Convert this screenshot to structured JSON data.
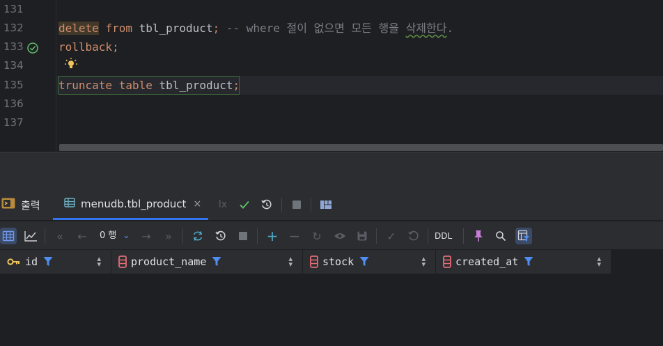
{
  "editor": {
    "line_numbers": [
      "131",
      "132",
      "133",
      "134",
      "135",
      "136",
      "137"
    ],
    "line132": {
      "kw_delete": "delete",
      "kw_from": "from",
      "ident": "tbl_product",
      "semicolon": ";",
      "comment_prefix": "-- where 절이 없으면 모든 행을 ",
      "comment_typo": "삭제한다",
      "comment_suffix": "."
    },
    "line133": {
      "kw_rollback": "rollback",
      "semicolon": ";"
    },
    "line135": {
      "kw_truncate": "truncate",
      "kw_table": "table",
      "ident": "tbl_product",
      "semicolon": ";"
    }
  },
  "tabs": {
    "output_label": "출력",
    "results_label": "menudb.tbl_product",
    "close_glyph": "×",
    "tx_label": "lx"
  },
  "toolbar": {
    "row_count": "0 행",
    "ddl_label": "DDL"
  },
  "grid": {
    "columns": [
      {
        "name": "id",
        "icon": "primary-key-icon"
      },
      {
        "name": "product_name",
        "icon": "column-icon"
      },
      {
        "name": "stock",
        "icon": "column-icon"
      },
      {
        "name": "created_at",
        "icon": "column-icon"
      }
    ]
  },
  "colors": {
    "keyword": "#cf8e6d",
    "comment": "#7a7e85",
    "accent": "#3574f0",
    "success": "#5fb865"
  }
}
